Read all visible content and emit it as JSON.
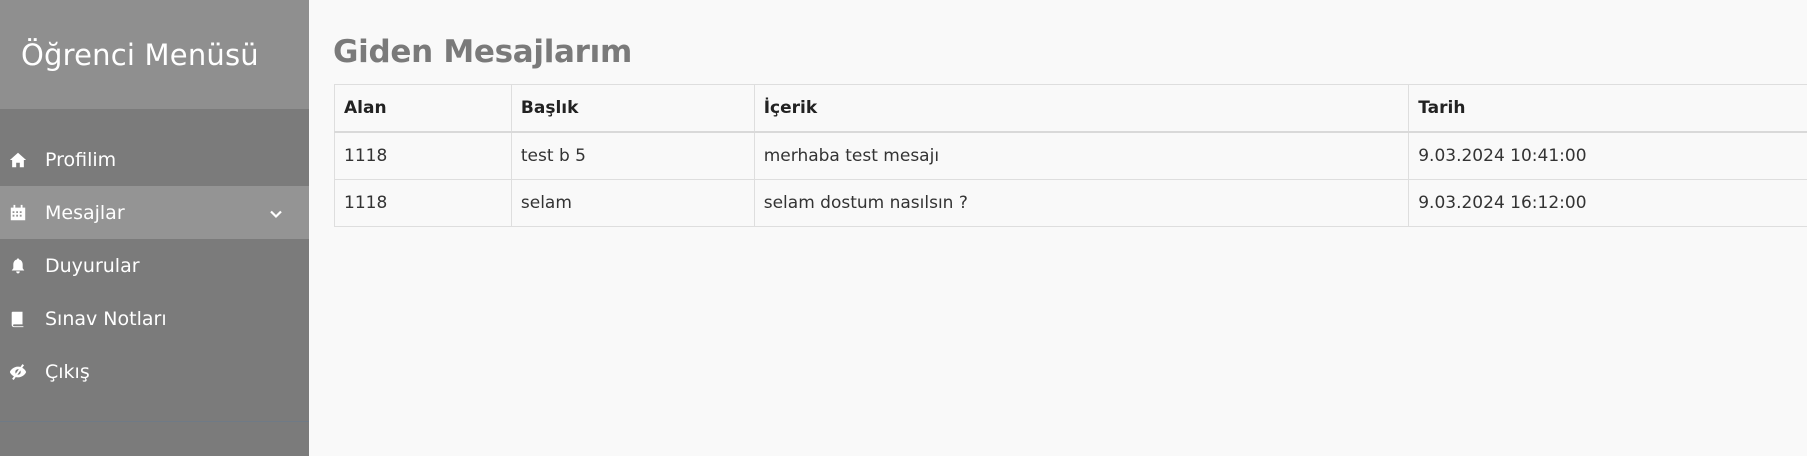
{
  "sidebar": {
    "title": "Öğrenci Menüsü",
    "items": [
      {
        "label": "Profilim",
        "icon": "home-icon",
        "active": false
      },
      {
        "label": "Mesajlar",
        "icon": "calendar-icon",
        "active": true,
        "expandable": true
      },
      {
        "label": "Duyurular",
        "icon": "bell-icon",
        "active": false
      },
      {
        "label": "Sınav Notları",
        "icon": "book-icon",
        "active": false
      },
      {
        "label": "Çıkış",
        "icon": "eye-slash-icon",
        "active": false
      }
    ]
  },
  "main": {
    "title": "Giden Mesajlarım",
    "table": {
      "headers": [
        "Alan",
        "Başlık",
        "İçerik",
        "Tarih"
      ],
      "rows": [
        [
          "1118",
          "test b 5",
          "merhaba test mesajı",
          "9.03.2024 10:41:00"
        ],
        [
          "1118",
          "selam",
          "selam dostum nasılsın ?",
          "9.03.2024 16:12:00"
        ]
      ]
    }
  },
  "colors": {
    "sidebar_bg": "#7b7b7b",
    "sidebar_header_bg": "#8f8f8f",
    "active_item_bg": "#949494",
    "page_bg": "#f9f9f9",
    "title_color": "#7a7a7a"
  }
}
